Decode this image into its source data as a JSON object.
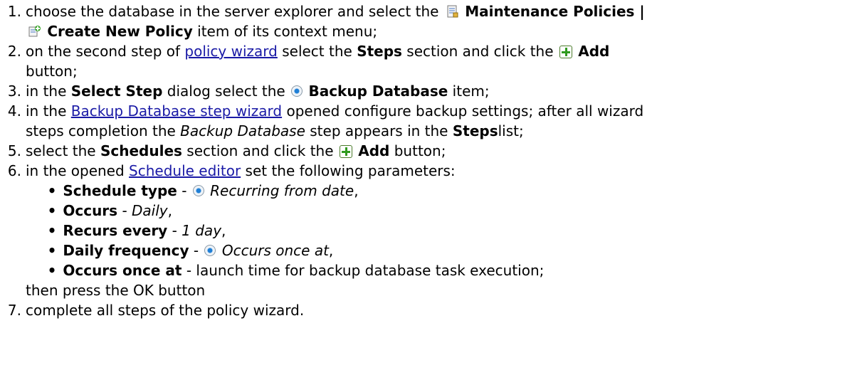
{
  "steps": {
    "s1": {
      "num": "1.",
      "a": "choose the database in the server explorer and select the",
      "b_policies": "Maintenance Policies |",
      "b_create": "Create New Policy",
      "c": "item of  its context menu;"
    },
    "s2": {
      "num": "2.",
      "a": "on the second step of",
      "link": "policy wizard",
      "b": "select the",
      "b_steps": "Steps",
      "c": "section and click the",
      "b_add": "Add",
      "d": "button;"
    },
    "s3": {
      "num": "3.",
      "a": "in the",
      "b_select": "Select Step",
      "b": "dialog select the",
      "b_backup": "Backup Database",
      "c": "item;"
    },
    "s4": {
      "num": "4.",
      "a": "in the",
      "link": "Backup Database step wizard",
      "b": "opened configure backup settings; after all wizard",
      "c": "steps completion the",
      "i_backup": "Backup Database",
      "d": "step appears in the",
      "b_steps": "Steps",
      "e": "list;"
    },
    "s5": {
      "num": "5.",
      "a": "select the",
      "b_schedules": "Schedules",
      "b": "section and click the",
      "b_add": "Add",
      "c": "button;"
    },
    "s6": {
      "num": "6.",
      "a": "in the opened",
      "link": "Schedule editor",
      "b": "set the following parameters:",
      "params": [
        {
          "name": "Schedule type",
          "sep": "-",
          "value": "Recurring from date",
          "tail": ","
        },
        {
          "name": "Occurs",
          "sep": "-",
          "value": "Daily",
          "tail": ","
        },
        {
          "name": "Recurs every",
          "sep": "-",
          "value": "1 day",
          "tail": ","
        },
        {
          "name": "Daily frequency",
          "sep": "-",
          "value": "Occurs once at",
          "tail": ","
        },
        {
          "name": "Occurs once at",
          "sep": "-",
          "value": "launch time for backup database task execution;",
          "tail": ""
        }
      ],
      "after": "then press the OK button"
    },
    "s7": {
      "num": "7.",
      "a": "complete all steps of the policy wizard."
    }
  },
  "icons": {
    "policies": "maintenance-policies-icon",
    "create": "create-policy-icon",
    "add": "green-plus-icon",
    "radio": "radio-selected-icon"
  },
  "colors": {
    "link": "#1a1aa6",
    "text": "#000000"
  }
}
